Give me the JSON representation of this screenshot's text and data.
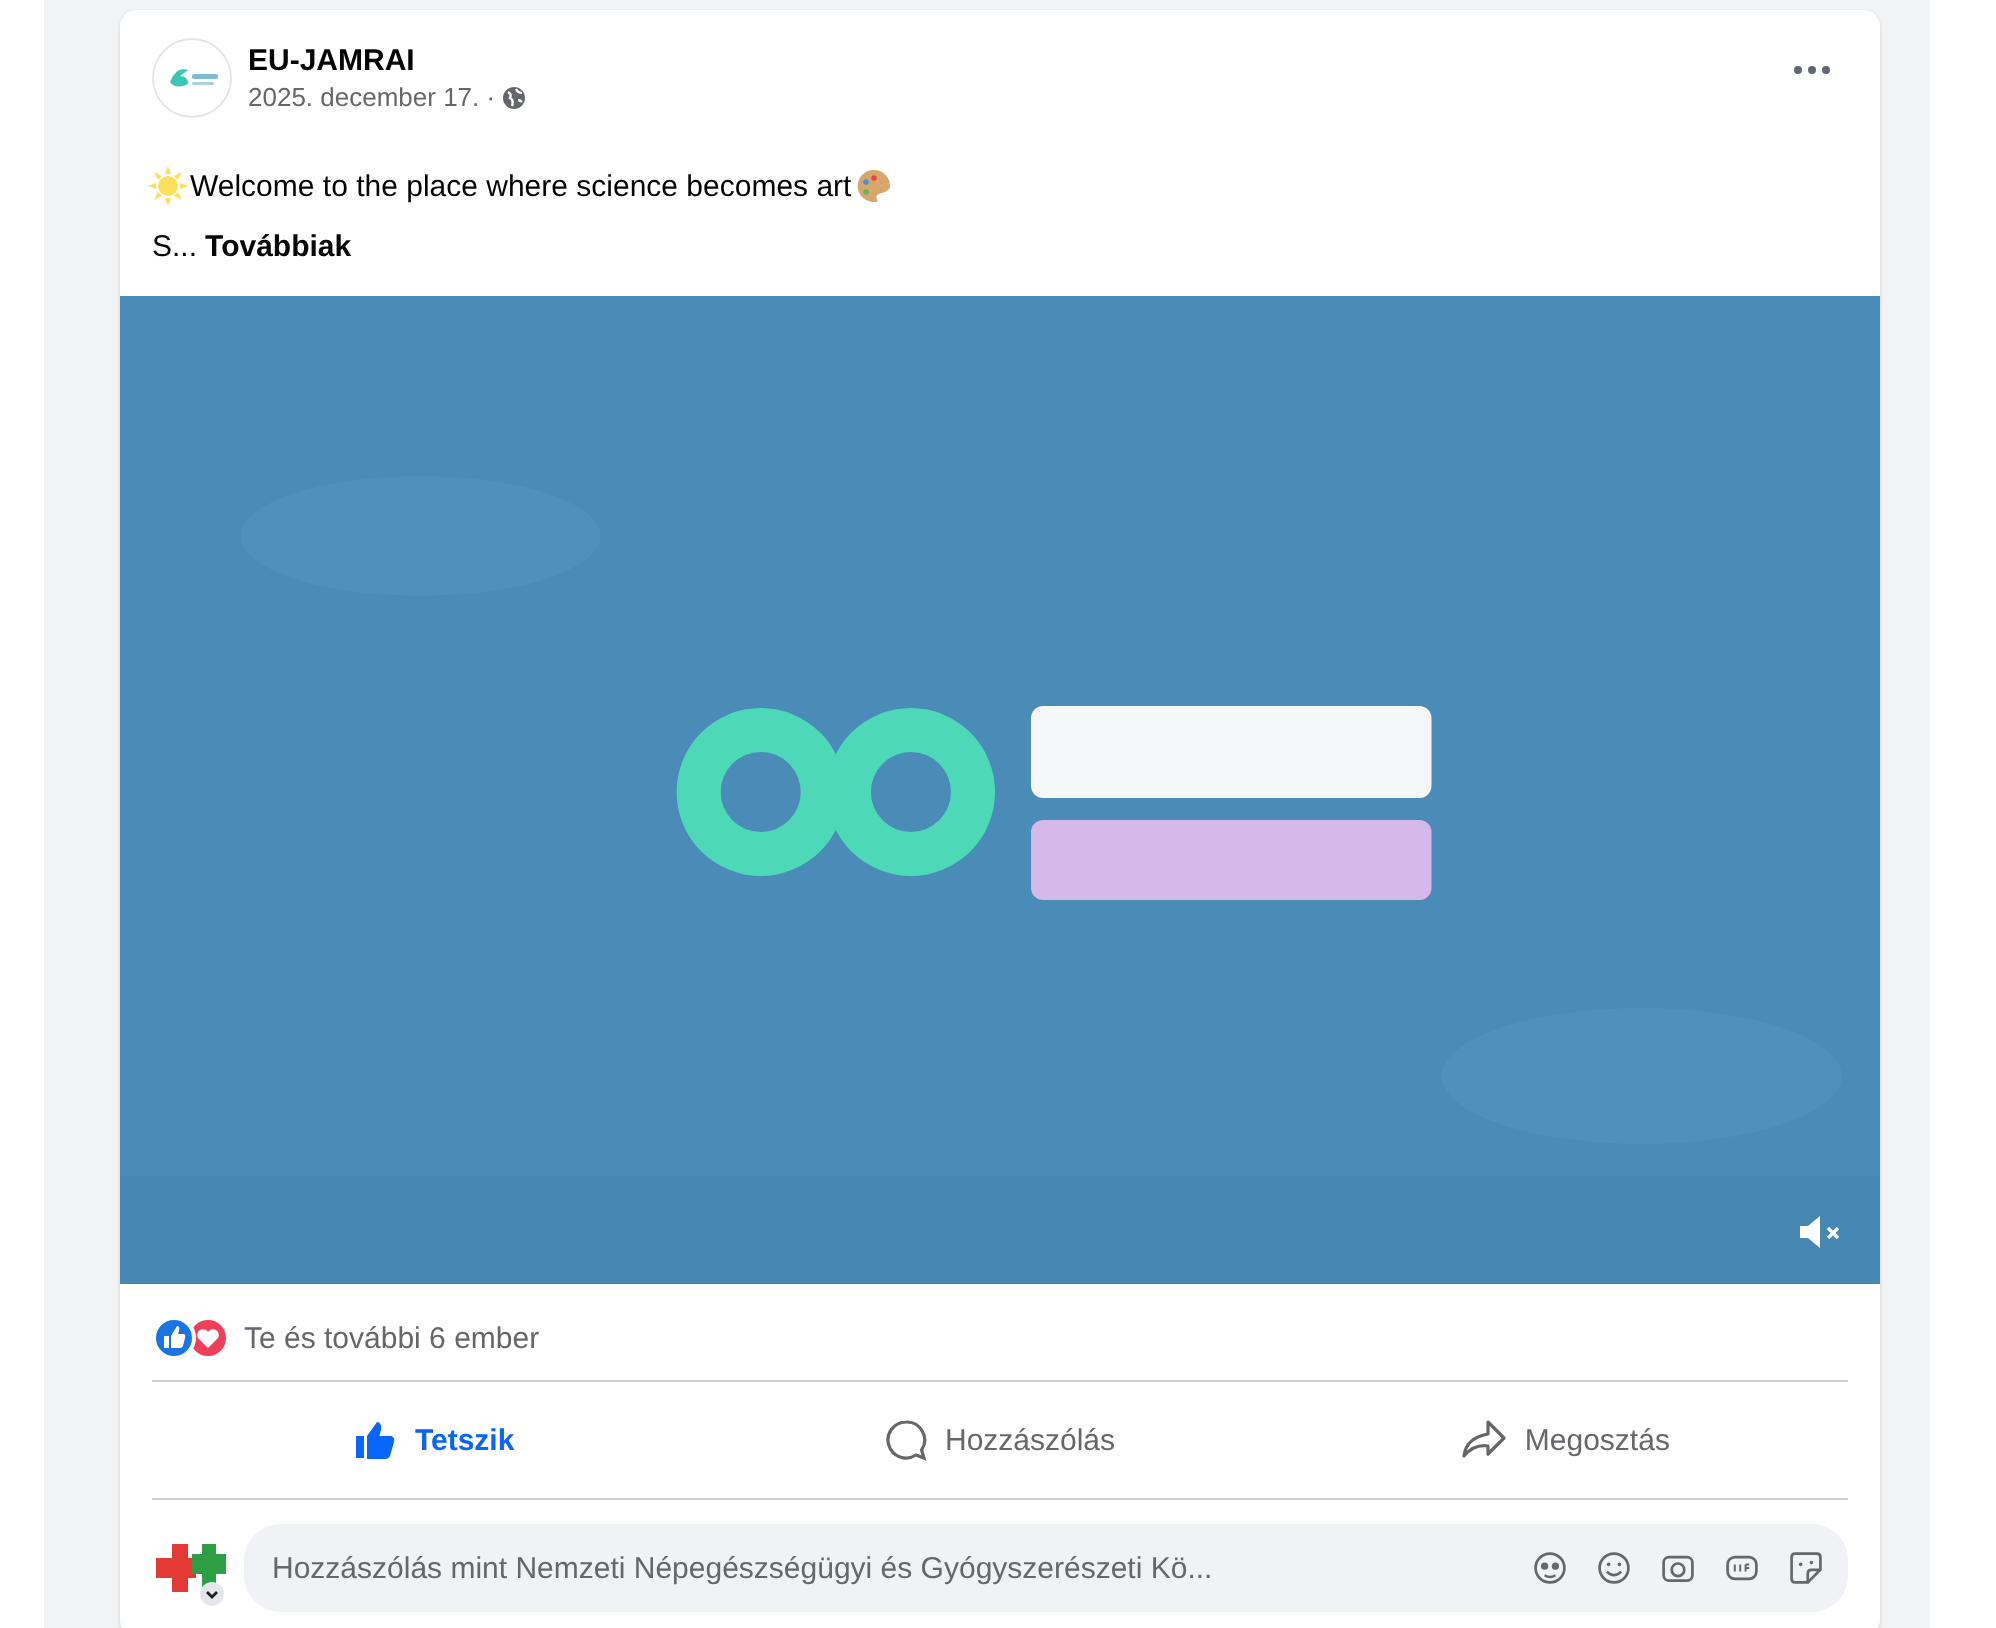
{
  "post": {
    "author": "EU-JAMRAI",
    "date": "2025. december 17. ·",
    "text": "Welcome to the place where science becomes art",
    "more_prefix": "S...",
    "more_link": "Továbbiak"
  },
  "video": {
    "kind": "picture",
    "muted": true
  },
  "reactions": {
    "summary": "Te és további 6 ember"
  },
  "actions": [
    {
      "kind": "like",
      "label": "Tetszik",
      "selected": true
    },
    {
      "kind": "comment",
      "label": "Hozzászólás",
      "selected": false
    },
    {
      "kind": "share",
      "label": "Megosztás",
      "selected": false
    }
  ],
  "comment_box": {
    "placeholder": "Hozzászólás mint Nemzeti Népegészségügyi és Gyógyszerészeti Kö..."
  }
}
